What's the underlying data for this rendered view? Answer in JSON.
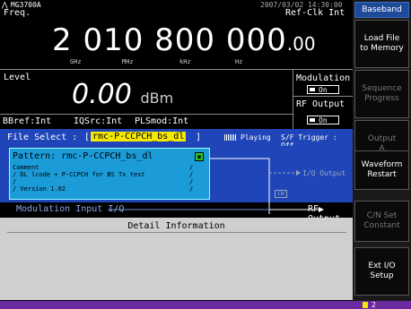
{
  "header": {
    "model": "MG3700A",
    "datetime": "2007/03/02  14:30:00",
    "tab_title": "Baseband"
  },
  "freq": {
    "label": "Freq.",
    "refclk": "Ref-Clk Int",
    "value_main": "2 010 800 000",
    "value_frac": ".00",
    "units": [
      "GHz",
      "MHz",
      "kHz",
      "Hz"
    ]
  },
  "level": {
    "label": "Level",
    "value": "0.00",
    "unit": "dBm",
    "modulation_label": "Modulation",
    "modulation_state": "On",
    "rf_output_label": "RF Output",
    "rf_output_state": "On"
  },
  "status_line": {
    "bbref": "BBref:Int",
    "iqsrc": "IQSrc:Int",
    "plsmod": "PLSmod:Int"
  },
  "file_select": {
    "label": "File Select : ",
    "value": "rmc-P-CCPCH_bs_dl",
    "playing": "Playing",
    "trigger": "S/F Trigger : Off"
  },
  "pattern": {
    "label": "Pattern: rmc-P-CCPCH_bs_dl",
    "comment_title": "Comment",
    "comment_lines": [
      "/ DL lcode + P-CCPCH for BS Tx test",
      "/",
      "/ Version 1.02"
    ],
    "lock_icon": "lock-icon"
  },
  "outputs": {
    "iq_output": "I/Q Output",
    "cw_label": "CW",
    "rf_output": "RF Output",
    "modulation_input": "Modulation Input I/Q"
  },
  "detail": {
    "title": "Detail Information"
  },
  "softkeys": [
    {
      "label": "Load File\nto Memory",
      "enabled": true
    },
    {
      "label": "Sequence\nProgress",
      "enabled": false
    },
    {
      "label": "Output\nA",
      "enabled": false
    },
    {
      "label": "Waveform\nRestart",
      "enabled": true
    },
    {
      "label": "C/N Set\nConstant",
      "enabled": false
    },
    {
      "label": "Ext I/O\nSetup",
      "enabled": true
    }
  ],
  "page_indicator": "2",
  "colors": {
    "accent_blue": "#1f45b8",
    "pattern_blue": "#1b9bd8",
    "highlight_yellow": "#f5e800",
    "bottom_bar": "#6a2aa0"
  }
}
